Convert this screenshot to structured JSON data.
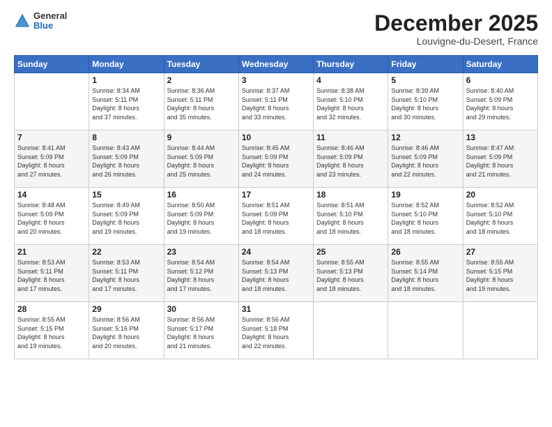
{
  "header": {
    "logo": {
      "line1": "General",
      "line2": "Blue"
    },
    "title": "December 2025",
    "location": "Louvigne-du-Desert, France"
  },
  "calendar": {
    "days_of_week": [
      "Sunday",
      "Monday",
      "Tuesday",
      "Wednesday",
      "Thursday",
      "Friday",
      "Saturday"
    ],
    "weeks": [
      [
        {
          "day": "",
          "info": ""
        },
        {
          "day": "1",
          "info": "Sunrise: 8:34 AM\nSunset: 5:11 PM\nDaylight: 8 hours\nand 37 minutes."
        },
        {
          "day": "2",
          "info": "Sunrise: 8:36 AM\nSunset: 5:11 PM\nDaylight: 8 hours\nand 35 minutes."
        },
        {
          "day": "3",
          "info": "Sunrise: 8:37 AM\nSunset: 5:11 PM\nDaylight: 8 hours\nand 33 minutes."
        },
        {
          "day": "4",
          "info": "Sunrise: 8:38 AM\nSunset: 5:10 PM\nDaylight: 8 hours\nand 32 minutes."
        },
        {
          "day": "5",
          "info": "Sunrise: 8:39 AM\nSunset: 5:10 PM\nDaylight: 8 hours\nand 30 minutes."
        },
        {
          "day": "6",
          "info": "Sunrise: 8:40 AM\nSunset: 5:09 PM\nDaylight: 8 hours\nand 29 minutes."
        }
      ],
      [
        {
          "day": "7",
          "info": "Sunrise: 8:41 AM\nSunset: 5:09 PM\nDaylight: 8 hours\nand 27 minutes."
        },
        {
          "day": "8",
          "info": "Sunrise: 8:43 AM\nSunset: 5:09 PM\nDaylight: 8 hours\nand 26 minutes."
        },
        {
          "day": "9",
          "info": "Sunrise: 8:44 AM\nSunset: 5:09 PM\nDaylight: 8 hours\nand 25 minutes."
        },
        {
          "day": "10",
          "info": "Sunrise: 8:45 AM\nSunset: 5:09 PM\nDaylight: 8 hours\nand 24 minutes."
        },
        {
          "day": "11",
          "info": "Sunrise: 8:46 AM\nSunset: 5:09 PM\nDaylight: 8 hours\nand 23 minutes."
        },
        {
          "day": "12",
          "info": "Sunrise: 8:46 AM\nSunset: 5:09 PM\nDaylight: 8 hours\nand 22 minutes."
        },
        {
          "day": "13",
          "info": "Sunrise: 8:47 AM\nSunset: 5:09 PM\nDaylight: 8 hours\nand 21 minutes."
        }
      ],
      [
        {
          "day": "14",
          "info": "Sunrise: 8:48 AM\nSunset: 5:09 PM\nDaylight: 8 hours\nand 20 minutes."
        },
        {
          "day": "15",
          "info": "Sunrise: 8:49 AM\nSunset: 5:09 PM\nDaylight: 8 hours\nand 19 minutes."
        },
        {
          "day": "16",
          "info": "Sunrise: 8:50 AM\nSunset: 5:09 PM\nDaylight: 8 hours\nand 19 minutes."
        },
        {
          "day": "17",
          "info": "Sunrise: 8:51 AM\nSunset: 5:09 PM\nDaylight: 8 hours\nand 18 minutes."
        },
        {
          "day": "18",
          "info": "Sunrise: 8:51 AM\nSunset: 5:10 PM\nDaylight: 8 hours\nand 18 minutes."
        },
        {
          "day": "19",
          "info": "Sunrise: 8:52 AM\nSunset: 5:10 PM\nDaylight: 8 hours\nand 18 minutes."
        },
        {
          "day": "20",
          "info": "Sunrise: 8:52 AM\nSunset: 5:10 PM\nDaylight: 8 hours\nand 18 minutes."
        }
      ],
      [
        {
          "day": "21",
          "info": "Sunrise: 8:53 AM\nSunset: 5:11 PM\nDaylight: 8 hours\nand 17 minutes."
        },
        {
          "day": "22",
          "info": "Sunrise: 8:53 AM\nSunset: 5:11 PM\nDaylight: 8 hours\nand 17 minutes."
        },
        {
          "day": "23",
          "info": "Sunrise: 8:54 AM\nSunset: 5:12 PM\nDaylight: 8 hours\nand 17 minutes."
        },
        {
          "day": "24",
          "info": "Sunrise: 8:54 AM\nSunset: 5:13 PM\nDaylight: 8 hours\nand 18 minutes."
        },
        {
          "day": "25",
          "info": "Sunrise: 8:55 AM\nSunset: 5:13 PM\nDaylight: 8 hours\nand 18 minutes."
        },
        {
          "day": "26",
          "info": "Sunrise: 8:55 AM\nSunset: 5:14 PM\nDaylight: 8 hours\nand 18 minutes."
        },
        {
          "day": "27",
          "info": "Sunrise: 8:55 AM\nSunset: 5:15 PM\nDaylight: 8 hours\nand 19 minutes."
        }
      ],
      [
        {
          "day": "28",
          "info": "Sunrise: 8:55 AM\nSunset: 5:15 PM\nDaylight: 8 hours\nand 19 minutes."
        },
        {
          "day": "29",
          "info": "Sunrise: 8:56 AM\nSunset: 5:16 PM\nDaylight: 8 hours\nand 20 minutes."
        },
        {
          "day": "30",
          "info": "Sunrise: 8:56 AM\nSunset: 5:17 PM\nDaylight: 8 hours\nand 21 minutes."
        },
        {
          "day": "31",
          "info": "Sunrise: 8:56 AM\nSunset: 5:18 PM\nDaylight: 8 hours\nand 22 minutes."
        },
        {
          "day": "",
          "info": ""
        },
        {
          "day": "",
          "info": ""
        },
        {
          "day": "",
          "info": ""
        }
      ]
    ]
  }
}
